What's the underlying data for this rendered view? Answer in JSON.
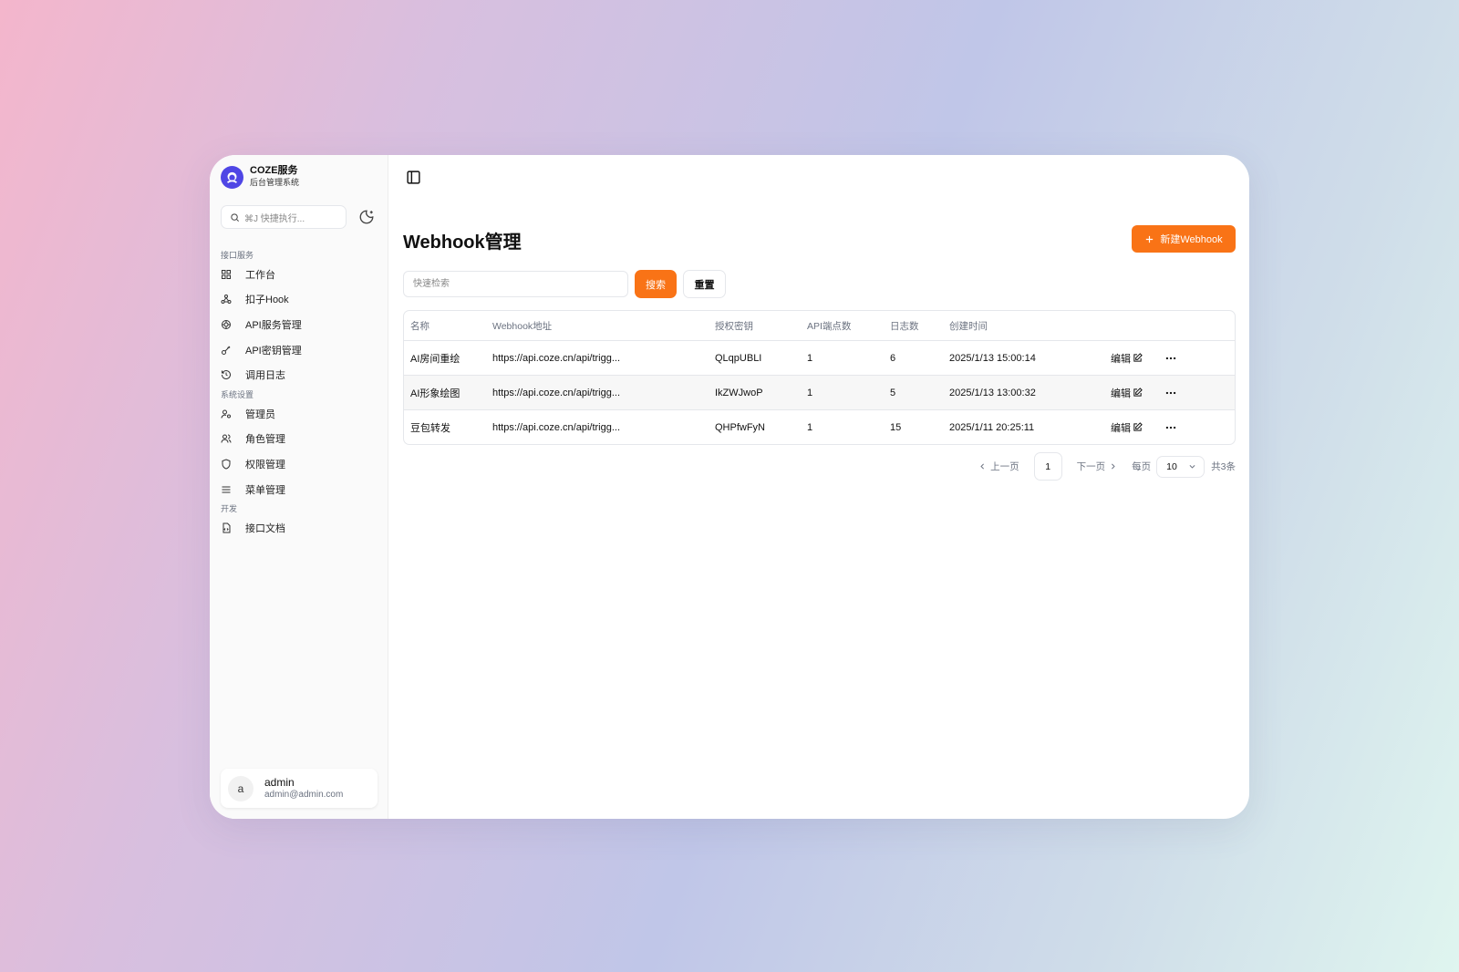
{
  "brand": {
    "title": "COZE服务",
    "subtitle": "后台管理系统"
  },
  "quick_search": {
    "placeholder": "⌘J 快捷执行..."
  },
  "sidebar": {
    "groups": [
      {
        "label": "接口服务",
        "items": [
          {
            "label": "工作台",
            "icon": "dashboard-icon"
          },
          {
            "label": "扣子Hook",
            "icon": "webhook-icon"
          },
          {
            "label": "API服务管理",
            "icon": "aperture-icon"
          },
          {
            "label": "API密钥管理",
            "icon": "key-icon"
          },
          {
            "label": "调用日志",
            "icon": "history-icon"
          }
        ]
      },
      {
        "label": "系统设置",
        "items": [
          {
            "label": "管理员",
            "icon": "user-cog-icon"
          },
          {
            "label": "角色管理",
            "icon": "users-icon"
          },
          {
            "label": "权限管理",
            "icon": "shield-icon"
          },
          {
            "label": "菜单管理",
            "icon": "menu-icon"
          }
        ]
      },
      {
        "label": "开发",
        "items": [
          {
            "label": "接口文档",
            "icon": "file-code-icon"
          }
        ]
      }
    ]
  },
  "user": {
    "initial": "a",
    "name": "admin",
    "email": "admin@admin.com"
  },
  "page": {
    "title": "Webhook管理",
    "new_button": "新建Webhook"
  },
  "filter": {
    "placeholder": "快速检索",
    "value": "",
    "search_label": "搜索",
    "reset_label": "重置"
  },
  "table": {
    "headers": [
      "名称",
      "Webhook地址",
      "授权密钥",
      "API端点数",
      "日志数",
      "创建时间"
    ],
    "edit_label": "编辑",
    "rows": [
      {
        "name": "AI房间重绘",
        "url": "https://api.coze.cn/api/trigg...",
        "key": "QLqpUBLI",
        "endpoints": "1",
        "logs": "6",
        "created": "2025/1/13 15:00:14"
      },
      {
        "name": "AI形象绘图",
        "url": "https://api.coze.cn/api/trigg...",
        "key": "IkZWJwoP",
        "endpoints": "1",
        "logs": "5",
        "created": "2025/1/13 13:00:32"
      },
      {
        "name": "豆包转发",
        "url": "https://api.coze.cn/api/trigg...",
        "key": "QHPfwFyN",
        "endpoints": "1",
        "logs": "15",
        "created": "2025/1/11 20:25:11"
      }
    ]
  },
  "pagination": {
    "prev": "上一页",
    "current": "1",
    "next": "下一页",
    "per_page_label": "每页",
    "page_size": "10",
    "total": "共3条"
  },
  "colors": {
    "accent": "#f97316",
    "brand": "#4f46e5"
  }
}
